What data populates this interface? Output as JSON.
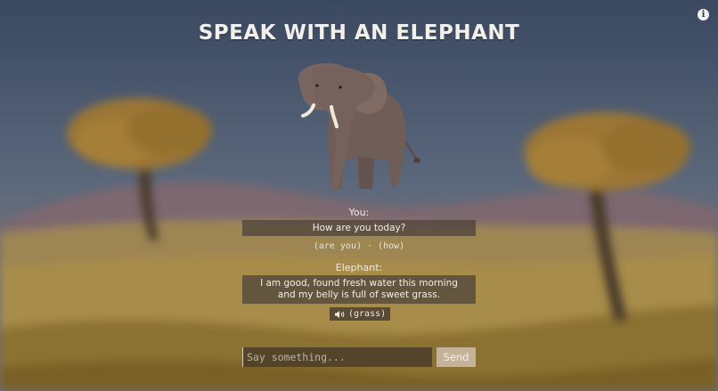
{
  "app": {
    "title": "SPEAK WITH AN ELEPHANT",
    "info_icon": "info-icon",
    "info_glyph": "i"
  },
  "colors": {
    "sky_top": "#3c4b63",
    "sky_mid": "#5c6a80",
    "hills": "#7a6670",
    "ground": "#a58a4b",
    "elephant": "#6e5b57",
    "tree_foliage": "#9d7936",
    "send_button": "#c4b299"
  },
  "conversation": {
    "you_label": "You:",
    "you_message": "How are you today?",
    "you_tokens": "(are you) · (how)",
    "elephant_label": "Elephant:",
    "elephant_message": "I am good, found fresh water this morning and my belly is full of sweet grass.",
    "elephant_tokens": "(grass)",
    "speaker_icon": "speaker-icon"
  },
  "composer": {
    "placeholder": "Say something...",
    "value": "",
    "send_label": "Send"
  }
}
